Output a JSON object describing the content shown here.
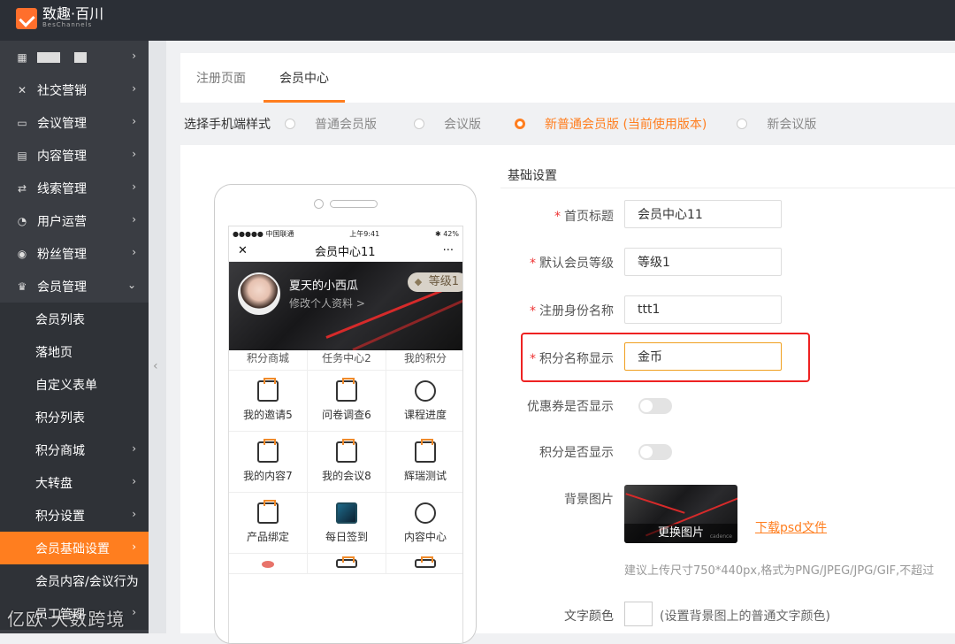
{
  "app": {
    "brand": "致趣·百川",
    "brand_sub": "BesChannels"
  },
  "sidebar": {
    "items": [
      {
        "label": "",
        "icon": "grid-icon"
      },
      {
        "label": "社交营销",
        "icon": "share-icon"
      },
      {
        "label": "会议管理",
        "icon": "monitor-icon"
      },
      {
        "label": "内容管理",
        "icon": "document-icon"
      },
      {
        "label": "线索管理",
        "icon": "funnel-icon"
      },
      {
        "label": "用户运营",
        "icon": "pie-icon"
      },
      {
        "label": "粉丝管理",
        "icon": "target-icon"
      },
      {
        "label": "会员管理",
        "icon": "crown-icon"
      }
    ],
    "sub_items": [
      {
        "label": "会员列表"
      },
      {
        "label": "落地页"
      },
      {
        "label": "自定义表单"
      },
      {
        "label": "积分列表"
      },
      {
        "label": "积分商城"
      },
      {
        "label": "大转盘"
      },
      {
        "label": "积分设置"
      },
      {
        "label": "会员基础设置"
      },
      {
        "label": "会员内容/会议行为"
      },
      {
        "label": "员工管理"
      }
    ]
  },
  "tabs": [
    {
      "label": "注册页面"
    },
    {
      "label": "会员中心"
    }
  ],
  "style_selector": {
    "label": "选择手机端样式",
    "options": [
      {
        "label": "普通会员版"
      },
      {
        "label": "会议版"
      },
      {
        "label": "新普通会员版 (当前使用版本)"
      },
      {
        "label": "新会议版"
      }
    ],
    "selected": "新普通会员版 (当前使用版本)"
  },
  "phone": {
    "status_left": "●●●●● 中国联通",
    "status_time": "上午9:41",
    "status_right": "✱ 42%",
    "title": "会员中心11",
    "close": "✕",
    "more": "···",
    "user_name": "夏天的小西瓜",
    "edit_profile": "修改个人资料 >",
    "level": "等级1",
    "top_row": [
      "积分商城",
      "任务中心2",
      "我的积分"
    ],
    "grid": [
      [
        "我的邀请5",
        "问卷调查6",
        "课程进度"
      ],
      [
        "我的内容7",
        "我的会议8",
        "辉瑞测试"
      ],
      [
        "产品绑定",
        "每日签到",
        "内容中心"
      ]
    ]
  },
  "form": {
    "section_title": "基础设置",
    "fields": [
      {
        "label": "首页标题",
        "value": "会员中心11",
        "required": true
      },
      {
        "label": "默认会员等级",
        "value": "等级1",
        "required": true
      },
      {
        "label": "注册身份名称",
        "value": "ttt1",
        "required": true
      },
      {
        "label": "积分名称显示",
        "value": "金币",
        "required": true
      }
    ],
    "toggles": [
      {
        "label": "优惠券是否显示",
        "on": false
      },
      {
        "label": "积分是否显示",
        "on": false
      }
    ],
    "bg_label": "背景图片",
    "bg_change": "更换图片",
    "bg_brand": "cadence",
    "download_psd": "下载psd文件",
    "hint": "建议上传尺寸750*440px,格式为PNG/JPEG/JPG/GIF,不超过",
    "text_color_label": "文字颜色",
    "text_color_hint": "(设置背景图上的普通文字颜色)"
  },
  "watermark": "亿欧 大数跨境",
  "colors": {
    "accent": "#ff7e1f",
    "sidebar": "#3a3d43",
    "topbar": "#2b2f36",
    "highlight": "#e22222"
  }
}
